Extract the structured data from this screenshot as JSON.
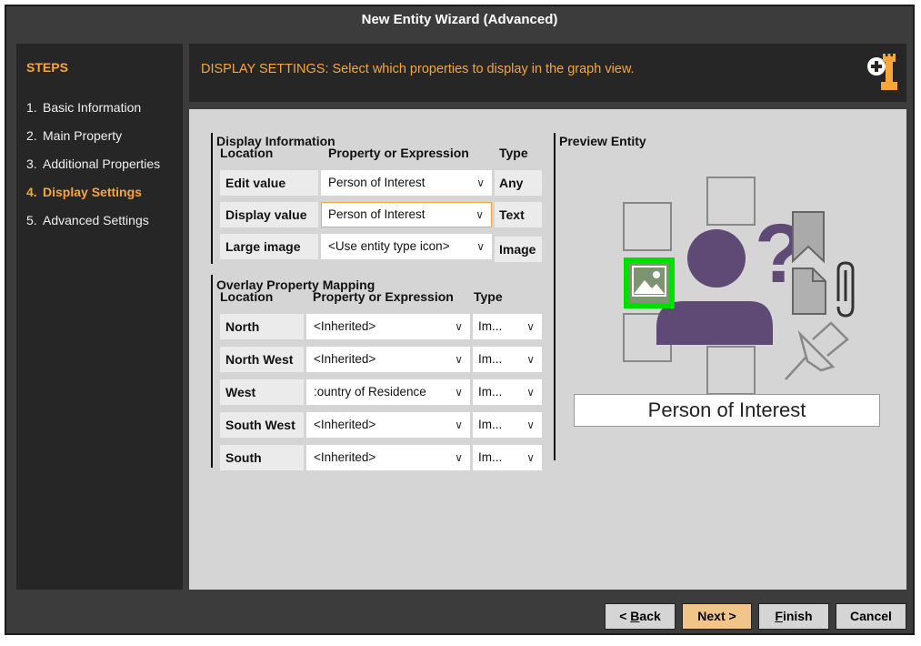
{
  "window": {
    "title": "New Entity Wizard (Advanced)"
  },
  "steps": {
    "title": "STEPS",
    "items": [
      {
        "num": "1.",
        "label": "Basic Information"
      },
      {
        "num": "2.",
        "label": "Main Property"
      },
      {
        "num": "3.",
        "label": "Additional Properties"
      },
      {
        "num": "4.",
        "label": "Display Settings"
      },
      {
        "num": "5.",
        "label": "Advanced Settings"
      }
    ]
  },
  "header": {
    "text": "DISPLAY SETTINGS: Select which properties to display in the graph view."
  },
  "display_info": {
    "title": "Display Information",
    "col_location": "Location",
    "col_property": "Property or Expression",
    "col_type": "Type",
    "rows": [
      {
        "label": "Edit value",
        "value": "Person of Interest",
        "type": "Any"
      },
      {
        "label": "Display value",
        "value": "Person of Interest",
        "type": "Text"
      },
      {
        "label": "Large image",
        "value": "<Use entity type icon>",
        "type": "Image"
      }
    ]
  },
  "overlay": {
    "title": "Overlay Property Mapping",
    "col_location": "Location",
    "col_property": "Property or Expression",
    "col_type": "Type",
    "rows": [
      {
        "label": "North",
        "value": "<Inherited>",
        "type": "Im..."
      },
      {
        "label": "North West",
        "value": "<Inherited>",
        "type": "Im..."
      },
      {
        "label": "West",
        "value": ":ountry of Residence",
        "type": "Im..."
      },
      {
        "label": "South West",
        "value": "<Inherited>",
        "type": "Im..."
      },
      {
        "label": "South",
        "value": "<Inherited>",
        "type": "Im..."
      }
    ]
  },
  "preview": {
    "title": "Preview Entity",
    "entity_label": "Person of Interest",
    "colors": {
      "person": "#5e4a74",
      "highlight": "#00e000",
      "image_icon": "#7d9470",
      "placeholder": "#888888"
    }
  },
  "buttons": {
    "back_prefix": "< ",
    "back_key": "B",
    "back_rest": "ack",
    "next": "Next >",
    "finish_key": "F",
    "finish_rest": "inish",
    "cancel": "Cancel"
  },
  "icons": {
    "chevron": "∨"
  },
  "colors": {
    "accent": "#f6a63b",
    "dark_panel": "#262626",
    "window_bg": "#3c3c3c",
    "content_bg": "#d5d5d5"
  }
}
